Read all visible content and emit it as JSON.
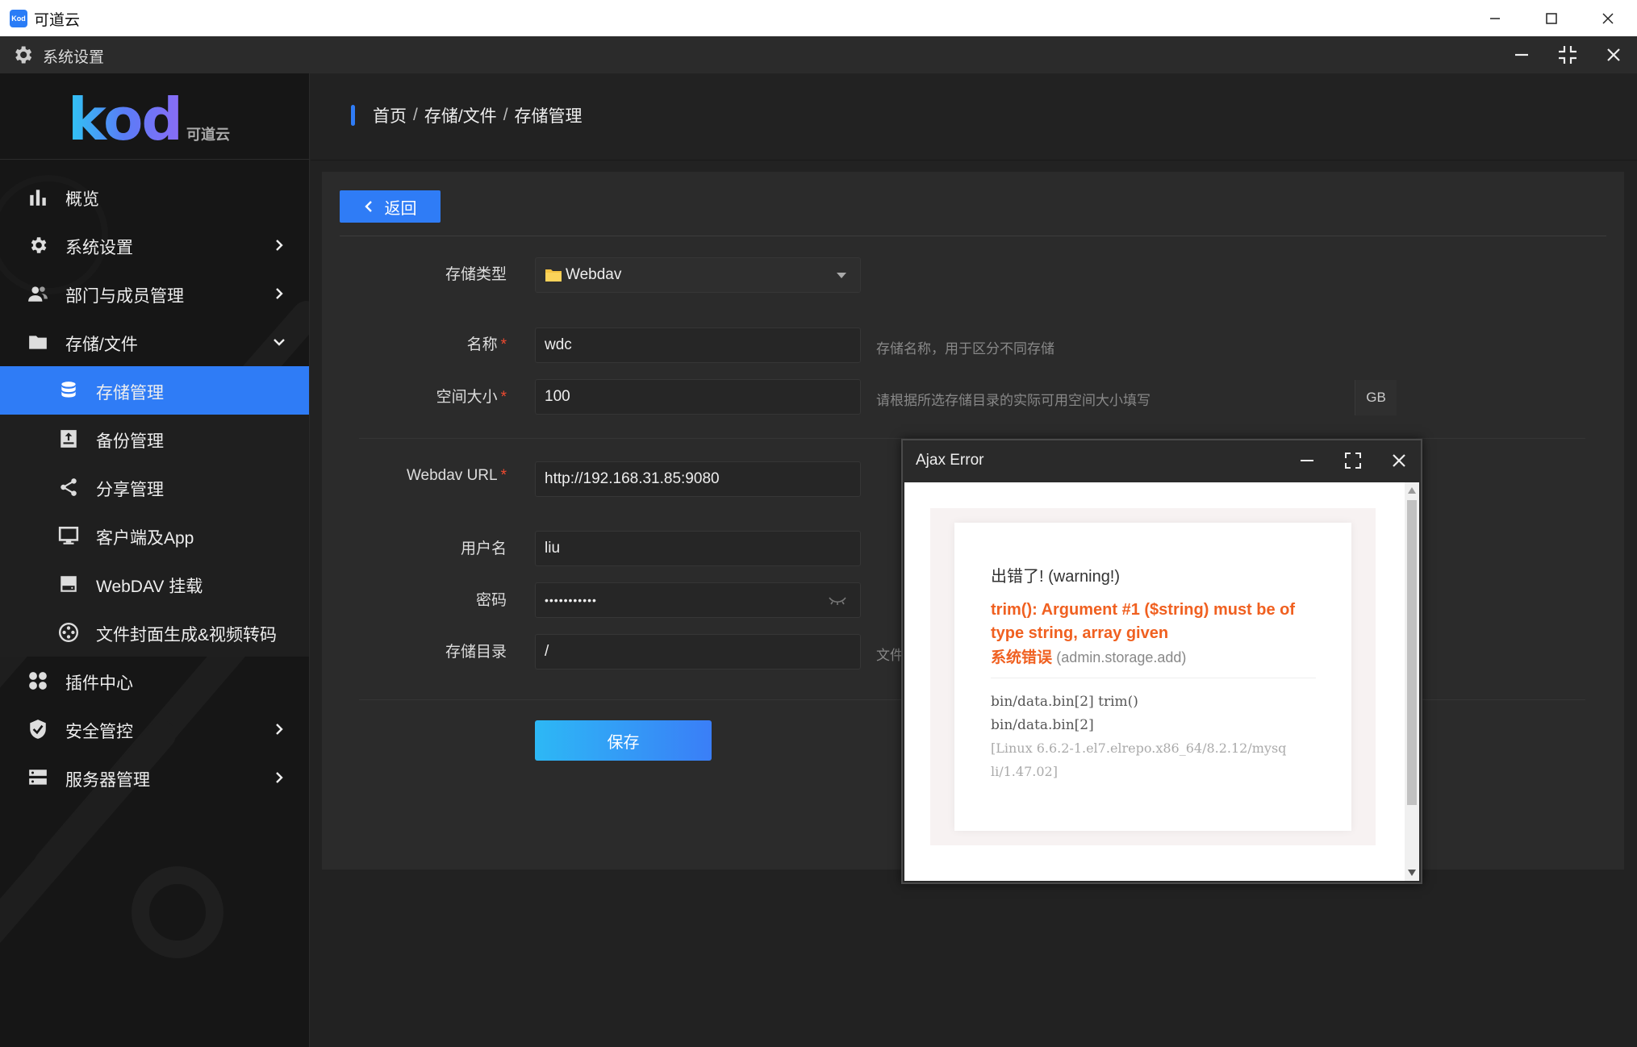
{
  "os": {
    "app_title": "可道云",
    "app_icon_text": "Kod"
  },
  "header": {
    "title": "系统设置"
  },
  "logo": {
    "brand": "kod",
    "sub": "可道云"
  },
  "sidebar": {
    "items": [
      {
        "label": "概览",
        "icon": "bar-chart-icon",
        "has_chevron": false
      },
      {
        "label": "系统设置",
        "icon": "gear-icon",
        "has_chevron": true
      },
      {
        "label": "部门与成员管理",
        "icon": "users-icon",
        "has_chevron": true
      },
      {
        "label": "存储/文件",
        "icon": "folder-icon",
        "has_chevron": true,
        "expanded": true
      },
      {
        "label": "插件中心",
        "icon": "plugin-icon",
        "has_chevron": false
      },
      {
        "label": "安全管控",
        "icon": "shield-icon",
        "has_chevron": true
      },
      {
        "label": "服务器管理",
        "icon": "server-icon",
        "has_chevron": true
      }
    ],
    "sub_items": [
      {
        "label": "存储管理",
        "icon": "database-icon",
        "active": true
      },
      {
        "label": "备份管理",
        "icon": "backup-icon"
      },
      {
        "label": "分享管理",
        "icon": "share-icon"
      },
      {
        "label": "客户端及App",
        "icon": "monitor-icon"
      },
      {
        "label": "WebDAV 挂载",
        "icon": "drive-icon"
      },
      {
        "label": "文件封面生成&视频转码",
        "icon": "film-icon"
      }
    ]
  },
  "breadcrumb": {
    "home": "首页",
    "sep": "/",
    "section": "存储/文件",
    "current": "存储管理"
  },
  "back_label": "返回",
  "form": {
    "storage_type": {
      "label": "存储类型",
      "value": "Webdav",
      "required": false
    },
    "name": {
      "label": "名称",
      "value": "wdc",
      "help": "存储名称，用于区分不同存储",
      "required": true
    },
    "size": {
      "label": "空间大小",
      "value": "100",
      "unit": "GB",
      "help": "请根据所选存储目录的实际可用空间大小填写",
      "required": true
    },
    "url": {
      "label": "Webdav URL",
      "value": "http://192.168.31.85:9080",
      "required": true
    },
    "username": {
      "label": "用户名",
      "value": "liu"
    },
    "password": {
      "label": "密码",
      "value": "•••••••••••"
    },
    "dir": {
      "label": "存储目录",
      "value": "/",
      "help": "文件"
    },
    "save_label": "保存",
    "req_mark": "*"
  },
  "dialog": {
    "title": "Ajax Error",
    "warning": "出错了! (warning!)",
    "message": "trim(): Argument #1 ($string) must be of type string, array given",
    "error_code": "系统错误",
    "action": "(admin.storage.add)",
    "trace": [
      "bin/data.bin[2] trim()",
      "bin/data.bin[2]"
    ],
    "env_line1": "[Linux 6.6.2-1.el7.elrepo.x86_64/8.2.12/mysq",
    "env_line2": "li/1.47.02]"
  },
  "colors": {
    "accent": "#2f7cf6",
    "error": "#f06020",
    "required": "#f04a30"
  }
}
